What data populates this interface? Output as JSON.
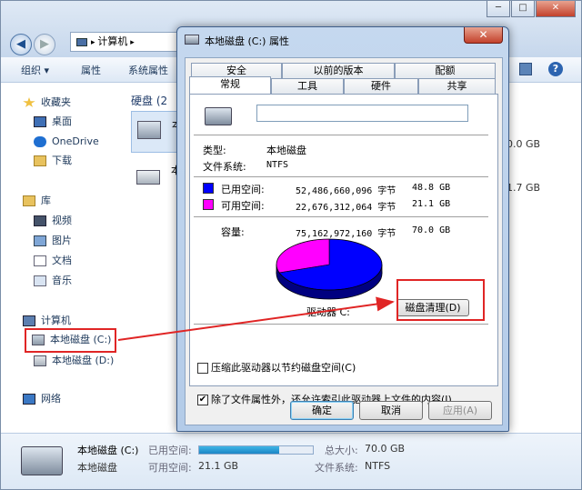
{
  "explorer": {
    "address": "计算机",
    "toolbar": [
      "组织 ▾",
      "属性",
      "系统属性"
    ],
    "window_controls": [
      "─",
      "□",
      "✕"
    ],
    "help": "?",
    "sidebar": {
      "favorites": "收藏夹",
      "desktop": "桌面",
      "onedrive": "OneDrive",
      "downloads": "下载",
      "libraries": "库",
      "videos": "视频",
      "pictures": "图片",
      "documents": "文档",
      "music": "音乐",
      "computer": "计算机",
      "drive_c": "本地磁盘 (C:)",
      "drive_d": "本地磁盘 (D:)",
      "network": "网络"
    },
    "content": {
      "group_header": "硬盘 (2",
      "drive1_label_start": "本",
      "drive1_size": "70.0 GB",
      "drive2_label_start": "本",
      "drive2_size": "41.7 GB"
    },
    "details": {
      "name": "本地磁盘 (C:)",
      "type": "本地磁盘",
      "used_label": "已用空间:",
      "used_fraction": 0.7,
      "free_label": "可用空间:",
      "free_value": "21.1 GB",
      "total_label": "总大小:",
      "total_value": "70.0 GB",
      "fs_label": "文件系统:",
      "fs_value": "NTFS"
    }
  },
  "dialog": {
    "title": "本地磁盘 (C:) 属性",
    "close": "✕",
    "tabs_row1": [
      "安全",
      "以前的版本",
      "配额"
    ],
    "tabs_row2": [
      "常规",
      "工具",
      "硬件",
      "共享"
    ],
    "drive_name_value": "",
    "type_label": "类型:",
    "type_value": "本地磁盘",
    "fs_label": "文件系统:",
    "fs_value": "NTFS",
    "used_label": "已用空间:",
    "used_bytes": "52,486,660,096 字节",
    "used_gb": "48.8 GB",
    "free_label": "可用空间:",
    "free_bytes": "22,676,312,064 字节",
    "free_gb": "21.1 GB",
    "capacity_label": "容量:",
    "capacity_bytes": "75,162,972,160 字节",
    "capacity_gb": "70.0 GB",
    "drive_label": "驱动器 C:",
    "cleanup_button": "磁盘清理(D)",
    "compress_label": "压缩此驱动器以节约磁盘空间(C)",
    "index_label": "除了文件属性外，还允许索引此驱动器上文件的内容(I)",
    "ok": "确定",
    "cancel": "取消",
    "apply": "应用(A)",
    "colors": {
      "used": "#0000ff",
      "free": "#ff00ff"
    }
  }
}
